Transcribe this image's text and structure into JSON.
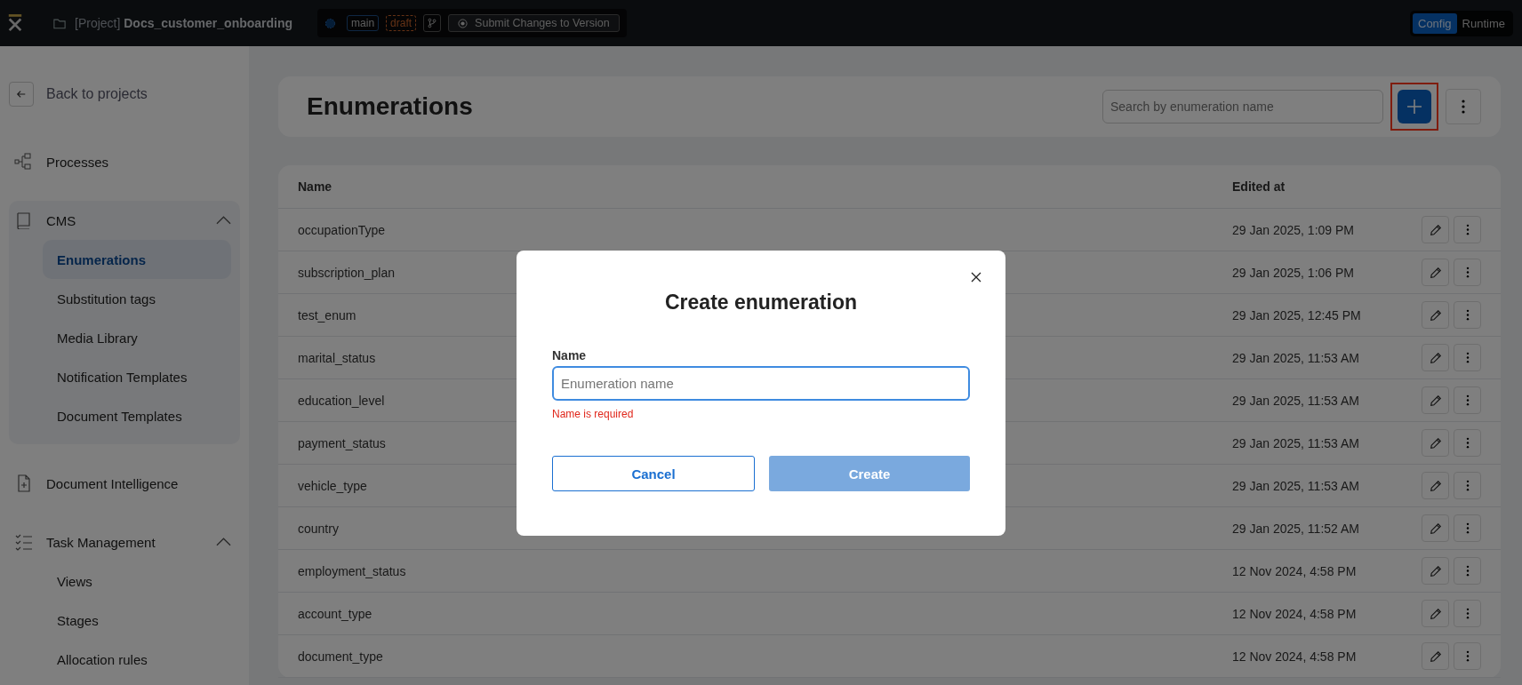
{
  "topbar": {
    "project_prefix": "[Project]",
    "project_name": "Docs_customer_onboarding",
    "branch": "main",
    "status": "draft",
    "submit_label": "Submit Changes to Version",
    "modes": [
      {
        "label": "Config",
        "selected": true
      },
      {
        "label": "Runtime",
        "selected": false
      }
    ]
  },
  "sidebar": {
    "back_label": "Back to projects",
    "items": [
      {
        "kind": "link",
        "label": "Processes"
      },
      {
        "kind": "section",
        "label": "CMS",
        "expanded": true,
        "children": [
          {
            "label": "Enumerations",
            "selected": true
          },
          {
            "label": "Substitution tags",
            "selected": false
          },
          {
            "label": "Media Library",
            "selected": false
          },
          {
            "label": "Notification Templates",
            "selected": false
          },
          {
            "label": "Document Templates",
            "selected": false
          }
        ]
      },
      {
        "kind": "link",
        "label": "Document Intelligence"
      },
      {
        "kind": "group",
        "label": "Task Management",
        "expanded": true,
        "children": [
          {
            "label": "Views",
            "selected": false
          },
          {
            "label": "Stages",
            "selected": false
          },
          {
            "label": "Allocation rules",
            "selected": false
          }
        ]
      }
    ]
  },
  "page": {
    "title": "Enumerations",
    "search": {
      "placeholder": "Search by enumeration name"
    },
    "add_button": {
      "highlighted": true
    }
  },
  "table": {
    "columns": [
      "Name",
      "Edited at"
    ],
    "rows": [
      {
        "name": "occupationType",
        "edited": "29 Jan 2025, 1:09 PM"
      },
      {
        "name": "subscription_plan",
        "edited": "29 Jan 2025, 1:06 PM"
      },
      {
        "name": "test_enum",
        "edited": "29 Jan 2025, 12:45 PM"
      },
      {
        "name": "marital_status",
        "edited": "29 Jan 2025, 11:53 AM"
      },
      {
        "name": "education_level",
        "edited": "29 Jan 2025, 11:53 AM"
      },
      {
        "name": "payment_status",
        "edited": "29 Jan 2025, 11:53 AM"
      },
      {
        "name": "vehicle_type",
        "edited": "29 Jan 2025, 11:53 AM"
      },
      {
        "name": "country",
        "edited": "29 Jan 2025, 11:52 AM"
      },
      {
        "name": "employment_status",
        "edited": "12 Nov 2024, 4:58 PM"
      },
      {
        "name": "account_type",
        "edited": "12 Nov 2024, 4:58 PM"
      },
      {
        "name": "document_type",
        "edited": "12 Nov 2024, 4:58 PM"
      }
    ]
  },
  "modal": {
    "title": "Create enumeration",
    "field_label": "Name",
    "placeholder": "Enumeration name",
    "error": "Name is required",
    "cancel_label": "Cancel",
    "create": {
      "label": "Create",
      "disabled": true
    }
  }
}
